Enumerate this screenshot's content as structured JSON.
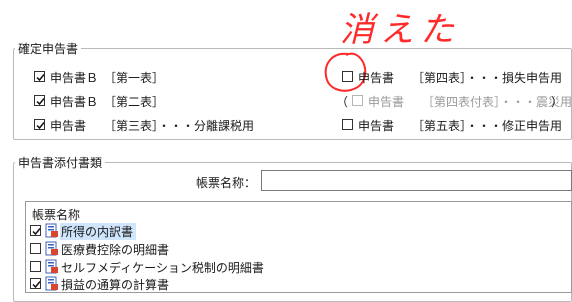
{
  "annotation": {
    "text": "消えた",
    "color": "#ff2a2a"
  },
  "confirmed": {
    "title": "確定申告書",
    "left": [
      {
        "label": "申告書Ｂ　［第一表］",
        "checked": true
      },
      {
        "label": "申告書Ｂ　［第二表］",
        "checked": true
      },
      {
        "label": "申告書　　［第三表］・・・分離課税用",
        "checked": true
      }
    ],
    "right": [
      {
        "label": "申告書　　［第四表］・・・損失申告用",
        "checked": false
      },
      {
        "label": "申告書　　［第四表付表］・・・震災用",
        "checked": false,
        "disabled": true,
        "prefix": "（",
        "suffix": "）"
      },
      {
        "label": "申告書　　［第五表］・・・修正申告用",
        "checked": false
      }
    ]
  },
  "attachments": {
    "title": "申告書添付書類",
    "form_name_label": "帳票名称：",
    "form_name_value": "",
    "list_header": "帳票名称",
    "items": [
      {
        "label": "所得の内訳書",
        "checked": true,
        "selected": true
      },
      {
        "label": "医療費控除の明細書",
        "checked": false
      },
      {
        "label": "セルフメディケーション税制の明細書",
        "checked": false
      },
      {
        "label": "損益の通算の計算書",
        "checked": true
      }
    ]
  },
  "colors": {
    "icon_blue": "#3d63b8",
    "icon_red": "#d9452e",
    "selection": "#cfe5fb"
  }
}
